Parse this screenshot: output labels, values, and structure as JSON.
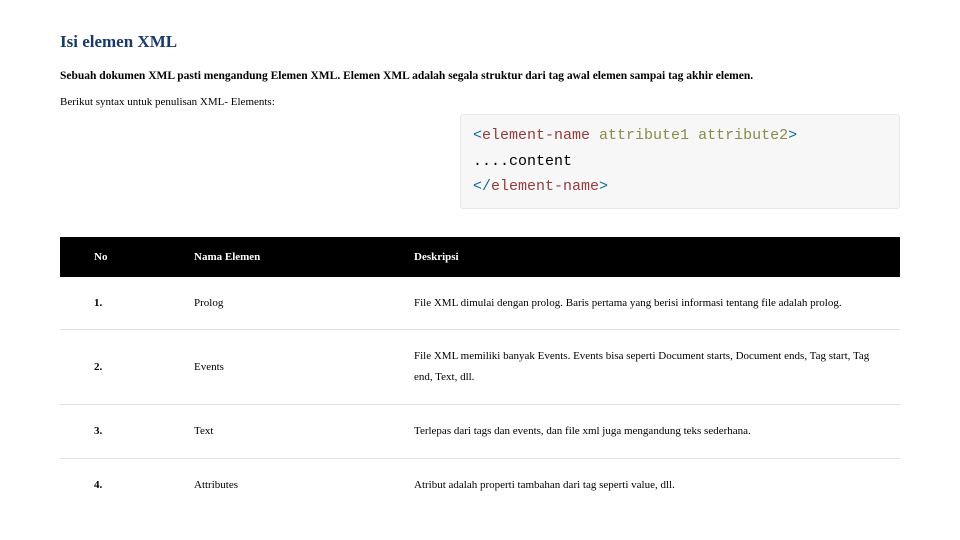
{
  "title": "Isi elemen XML",
  "intro": "Sebuah dokumen XML pasti mengandung Elemen XML. Elemen XML adalah segala struktur dari tag awal elemen sampai tag akhir elemen.",
  "syntax_note": "Berikut syntax untuk penulisan XML- Elements:",
  "code": {
    "line1_open_lt": "<",
    "line1_name": "element-name",
    "line1_attr1": " attribute1",
    "line1_attr2": " attribute2",
    "line1_open_gt": ">",
    "line2": "....content",
    "line3_close_lt": "</",
    "line3_name": "element-name",
    "line3_close_gt": ">"
  },
  "table": {
    "headers": {
      "no": "No",
      "name": "Nama Elemen",
      "desc": "Deskripsi"
    },
    "rows": [
      {
        "no": "1.",
        "name": "Prolog",
        "desc": "File XML dimulai dengan prolog. Baris pertama yang berisi informasi tentang file adalah prolog."
      },
      {
        "no": "2.",
        "name": "Events",
        "desc": "File XML memiliki banyak Events. Events bisa seperti Document starts, Document ends, Tag start, Tag end, Text, dll."
      },
      {
        "no": "3.",
        "name": "Text",
        "desc": "Terlepas dari tags dan events, dan file xml juga mengandung teks sederhana."
      },
      {
        "no": "4.",
        "name": "Attributes",
        "desc": "Atribut adalah properti tambahan dari tag seperti value, dll."
      }
    ]
  }
}
